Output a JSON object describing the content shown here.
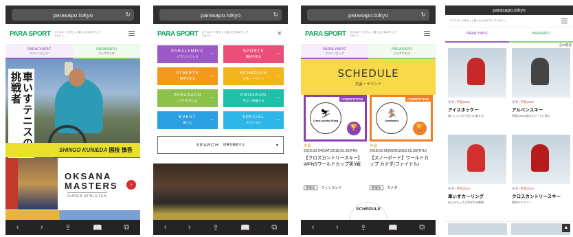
{
  "url": "parasapo.tokyo",
  "url_small": "parasapo.tokyo",
  "logo": "PARA SPORT",
  "tagline": "パラスポーツをもっと楽しむためのウェブマガジン",
  "tabs": {
    "para_label": "PARALYMPIC",
    "para_sub": "パラリンピック",
    "sports_label": "PARASAPO",
    "sports_sub": "パラサポとは"
  },
  "hero": {
    "vertical_text": "車いすテニスの挑戦者",
    "vertical_text2": "挑戦者",
    "name_en": "SHINGO KUNIEDA",
    "name_jp": "国枝 慎吾"
  },
  "card2": {
    "title1": "OKSANA",
    "title2": "MASTERS",
    "subtitle": "SUPER ATHLETES"
  },
  "menu": {
    "items": [
      {
        "label": "PARALYMPIC",
        "sub": "パラリンピック",
        "color": "#9b59c6"
      },
      {
        "label": "SPORTS",
        "sub": "競技を知る",
        "color": "#ea4f7a"
      },
      {
        "label": "ATHLETE",
        "sub": "選手を知る",
        "color": "#f29a1e"
      },
      {
        "label": "SCHEDULE",
        "sub": "大会・イベント",
        "color": "#f2b51e"
      },
      {
        "label": "PARASAPO",
        "sub": "パラサポとは",
        "color": "#8bc34a"
      },
      {
        "label": "PROGRAM",
        "sub": "学ぶ・体験する",
        "color": "#1fbfa8"
      },
      {
        "label": "EVENT",
        "sub": "楽しむ",
        "color": "#2aa0e0"
      },
      {
        "label": "SPECIAL",
        "sub": "スペシャル",
        "color": "#2fb6e8"
      }
    ],
    "search_label": "SEARCH",
    "search_sub": "記事を検索する"
  },
  "schedule": {
    "title": "SCHEDULE",
    "subtitle": "大会・イベント",
    "events": [
      {
        "badge": "COMPETITION",
        "sport": "Cross-country Skiing",
        "label": "大会",
        "date": "2018.02.04(SAT)2018.02.05(FRI)",
        "title": "【クロスカントリースキー】WPNSワールドカップ第3戦",
        "tag": "開催地",
        "place": "フィンランド",
        "color": "#8a3fb8"
      },
      {
        "badge": "COMPETITION",
        "sport": "Snowboard",
        "label": "大会",
        "date": "2018.02.05(MON)2018.02.09(THU)",
        "title": "【スノーボード】ワールドカップ カナダ(ファイナル)",
        "tag": "開催地",
        "place": "カナダ",
        "color": "#f07f2a"
      }
    ],
    "logo_text": "SCHEDULE"
  },
  "sports": {
    "count": "全50競技",
    "items": [
      {
        "season": "冬季",
        "tag": "平昌2018",
        "title": "アイスホッケー",
        "desc": "激しいぶつかり合いに魅せる"
      },
      {
        "season": "冬季",
        "tag": "平昌2018",
        "title": "アルペンスキー",
        "desc": "時速100km超のスピードに挑む"
      },
      {
        "season": "冬季",
        "tag": "平昌2018",
        "title": "車いすカーリング",
        "desc": "氷上のチェスと呼ばれる戦略"
      },
      {
        "season": "冬季",
        "tag": "平昌2018",
        "title": "クロスカントリースキー",
        "desc": "雪原のマラソン"
      }
    ]
  },
  "toolbar": {
    "back": "‹",
    "forward": "›",
    "share": "⇪",
    "bookmarks": "📖",
    "tabs": "⧉"
  },
  "reload": "↻",
  "close": "×",
  "dropdown": "▾",
  "scrolltop": "▲"
}
